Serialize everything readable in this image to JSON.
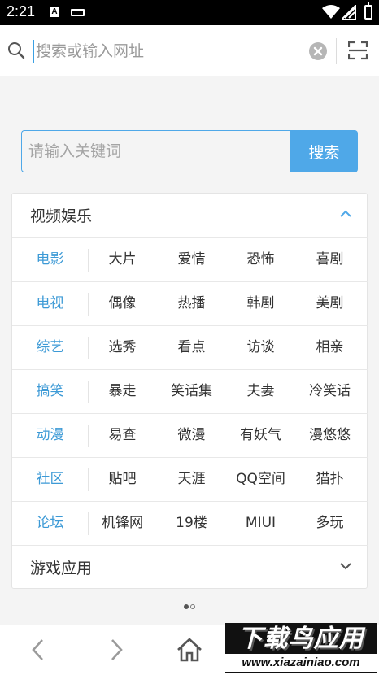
{
  "status_bar": {
    "time": "2:21",
    "a_badge": "A"
  },
  "url_bar": {
    "placeholder": "搜索或输入网址"
  },
  "keyword_search": {
    "placeholder": "请输入关键词",
    "button_label": "搜索"
  },
  "sections": {
    "video": {
      "title": "视频娱乐",
      "expanded": true,
      "rows": [
        {
          "category": "电影",
          "links": [
            "大片",
            "爱情",
            "恐怖",
            "喜剧"
          ]
        },
        {
          "category": "电视",
          "links": [
            "偶像",
            "热播",
            "韩剧",
            "美剧"
          ]
        },
        {
          "category": "综艺",
          "links": [
            "选秀",
            "看点",
            "访谈",
            "相亲"
          ]
        },
        {
          "category": "搞笑",
          "links": [
            "暴走",
            "笑话集",
            "夫妻",
            "冷笑话"
          ]
        },
        {
          "category": "动漫",
          "links": [
            "易查",
            "微漫",
            "有妖气",
            "漫悠悠"
          ]
        },
        {
          "category": "社区",
          "links": [
            "贴吧",
            "天涯",
            "QQ空间",
            "猫扑"
          ]
        },
        {
          "category": "论坛",
          "links": [
            "机锋网",
            "19楼",
            "MIUI",
            "多玩"
          ]
        }
      ]
    },
    "games": {
      "title": "游戏应用",
      "expanded": false
    }
  },
  "pager": {
    "total": 2,
    "active": 1
  },
  "bottom_nav": {
    "icons": [
      "back-icon",
      "forward-icon",
      "home-icon"
    ]
  },
  "watermark": {
    "logo_text": "下载鸟应用",
    "url": "www.xiazainiao.com"
  },
  "colors": {
    "accent": "#4fa8e8",
    "category_text": "#3d9ad6",
    "status_bar": "#000000"
  }
}
